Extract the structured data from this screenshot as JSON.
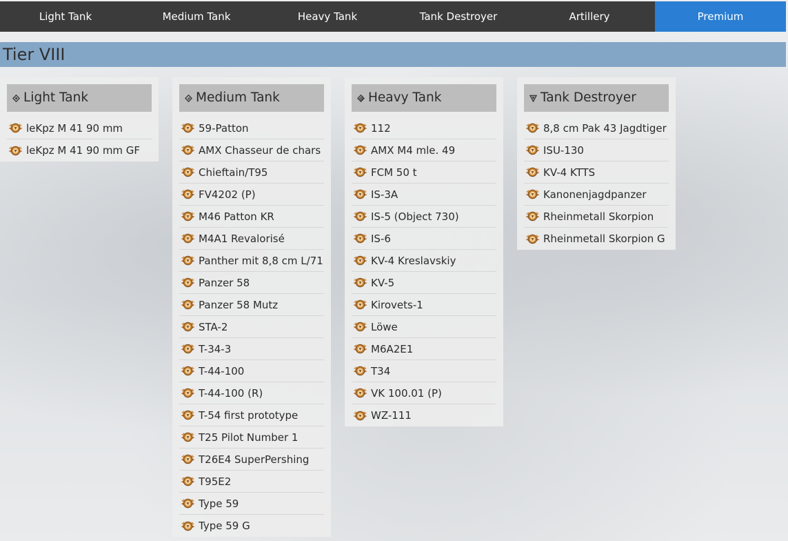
{
  "nav": {
    "tabs": [
      {
        "label": "Light Tank"
      },
      {
        "label": "Medium Tank"
      },
      {
        "label": "Heavy Tank"
      },
      {
        "label": "Tank Destroyer"
      },
      {
        "label": "Artillery"
      },
      {
        "label": "Premium",
        "active": true
      }
    ]
  },
  "tier": {
    "title": "Tier VIII"
  },
  "colors": {
    "nav_bg": "#3b3b3b",
    "nav_active": "#2a7ed3",
    "tier_bar": "#84a6c6",
    "column_header": "#bdbdbd",
    "medal_gold": "#c9822f"
  },
  "columns": [
    {
      "title": "Light Tank",
      "icon": "light-tank-class-icon",
      "items": [
        "leKpz M 41 90 mm",
        "leKpz M 41 90 mm GF"
      ]
    },
    {
      "title": "Medium Tank",
      "icon": "medium-tank-class-icon",
      "items": [
        "59-Patton",
        "AMX Chasseur de chars",
        "Chieftain/T95",
        "FV4202 (P)",
        "M46 Patton KR",
        "M4A1 Revalorisé",
        "Panther mit 8,8 cm L/71",
        "Panzer 58",
        "Panzer 58 Mutz",
        "STA-2",
        "T-34-3",
        "T-44-100",
        "T-44-100 (R)",
        "T-54 first prototype",
        "T25 Pilot Number 1",
        "T26E4 SuperPershing",
        "T95E2",
        "Type 59",
        "Type 59 G"
      ]
    },
    {
      "title": "Heavy Tank",
      "icon": "heavy-tank-class-icon",
      "items": [
        "112",
        "AMX M4 mle. 49",
        "FCM 50 t",
        "IS-3A",
        "IS-5 (Object 730)",
        "IS-6",
        "KV-4 Kreslavskiy",
        "KV-5",
        "Kirovets-1",
        "Löwe",
        "M6A2E1",
        "T34",
        "VK 100.01 (P)",
        "WZ-111"
      ]
    },
    {
      "title": "Tank Destroyer",
      "icon": "tank-destroyer-class-icon",
      "items": [
        "8,8 cm Pak 43 Jagdtiger",
        "ISU-130",
        "KV-4 KTTS",
        "Kanonenjagdpanzer",
        "Rheinmetall Skorpion",
        "Rheinmetall Skorpion G"
      ]
    }
  ]
}
